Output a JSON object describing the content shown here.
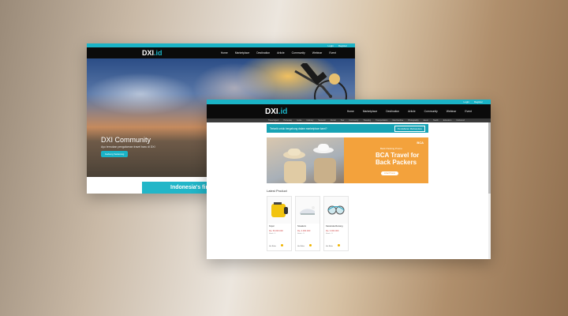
{
  "back": {
    "login": "Login",
    "register": "Register",
    "logo": "DXI",
    "logo_tld": ".id",
    "menu": [
      "Home",
      "Marketplace",
      "Destination",
      "Article",
      "Community",
      "Webinar",
      "Event"
    ],
    "hero_title": "DXI Community",
    "hero_sub": "Ayo temukan pengalaman travel baru di DXI",
    "hero_btn": "Gabung Sekarang",
    "banner": "Indonesia's first"
  },
  "front": {
    "login": "Login",
    "register": "Register",
    "logo": "DXI",
    "logo_tld": ".id",
    "menu": [
      "Home",
      "Marketplace",
      "Destination",
      "Article",
      "Community",
      "Webinar",
      "Event"
    ],
    "submenu": [
      "Travel Agent",
      "Homestay",
      "Guide",
      "Culinary",
      "Souvenir",
      "Rental",
      "Tour",
      "Community",
      "Traveling",
      "Transportation",
      "Merchandise",
      "Photography",
      "Event",
      "Health",
      "Education",
      "Outbound"
    ],
    "promo_text": "Tertarik untuk bergabung dalam marketplace kami?",
    "promo_btn": "Pendaftaran Marketplace",
    "ad": {
      "brand": "BCA",
      "small": "Back Packing Promo",
      "title": "BCA Travel for Back Packers",
      "btn": "Lihat Promo"
    },
    "latest_label": "Latest Product",
    "products": [
      {
        "name": "Koper",
        "price": "Rp. 50.000.000",
        "stock": "Stock : 1",
        "seller": "Hai Bubu"
      },
      {
        "name": "Sneakers",
        "price": "Rp. 4.000.000",
        "stock": "Stock : 3",
        "seller": "Hai Bubu"
      },
      {
        "name": "Kacamata Renang",
        "price": "Rp. 3.000.000",
        "stock": "Stock : 3",
        "seller": "Hai Bubu"
      }
    ]
  }
}
